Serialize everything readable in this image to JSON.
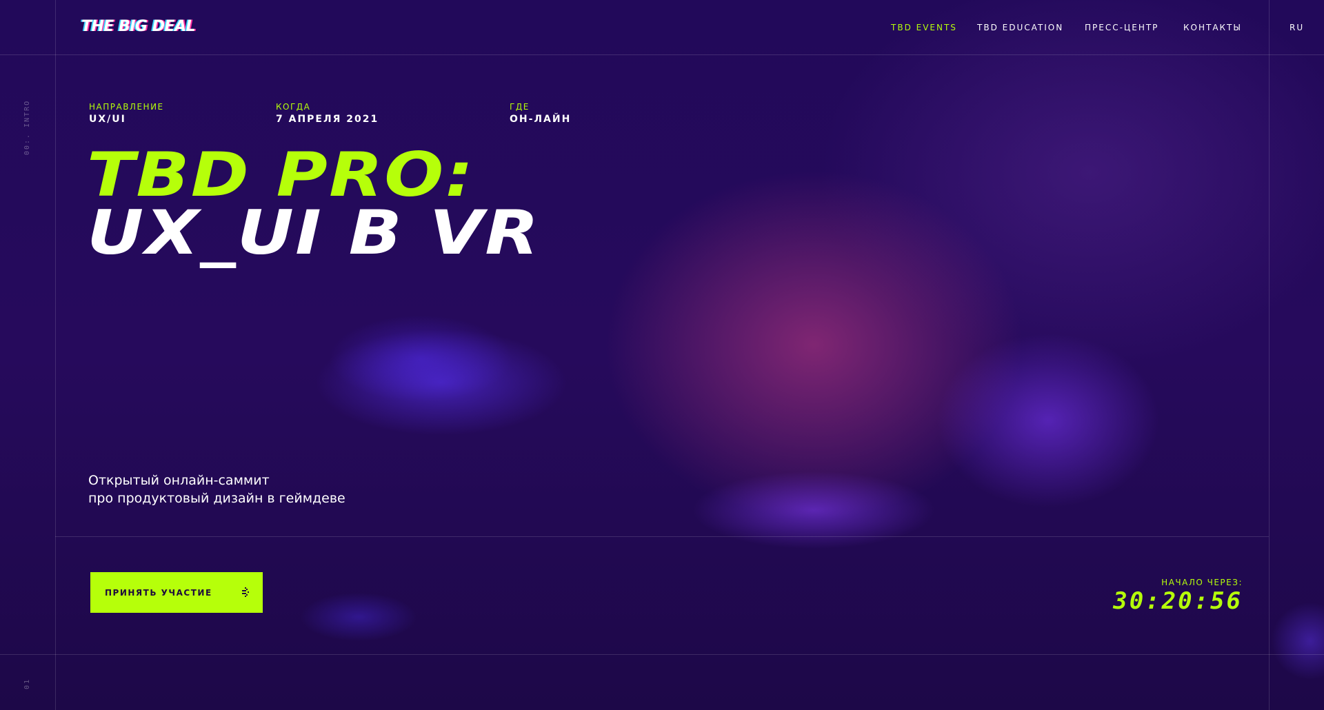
{
  "brand": {
    "logo_text": "THE BIG DEAL"
  },
  "nav": {
    "items": [
      {
        "label": "TBD EVENTS",
        "active": true
      },
      {
        "label": "TBD EDUCATION",
        "active": false
      },
      {
        "label": "ПРЕСС-ЦЕНТР",
        "active": false
      },
      {
        "label": "КОНТАКТЫ",
        "active": false
      }
    ],
    "language": "RU"
  },
  "side_labels": {
    "section": "00:. INTRO",
    "page": "01"
  },
  "event_meta": {
    "direction": {
      "label": "НАПРАВЛЕНИЕ",
      "value": "UX/UI"
    },
    "when": {
      "label": "КОГДА",
      "value": "7 АПРЕЛЯ 2021"
    },
    "where": {
      "label": "ГДЕ",
      "value": "ОН-ЛАЙН"
    }
  },
  "headline": {
    "line1": "TBD PRO:",
    "line2": "UX_UI В VR"
  },
  "subtitle": {
    "line1": "Открытый онлайн-саммит",
    "line2": "про продуктовый дизайн в геймдеве"
  },
  "cta": {
    "label": "ПРИНЯТЬ УЧАСТИЕ"
  },
  "countdown": {
    "label": "НАЧАЛО ЧЕРЕЗ:",
    "value": "30:20:56"
  },
  "colors": {
    "accent": "#b6ff0a",
    "background": "#22095a",
    "text": "#ffffff"
  },
  "icons": {
    "cta_icon": "sparkle-arrow-icon"
  }
}
